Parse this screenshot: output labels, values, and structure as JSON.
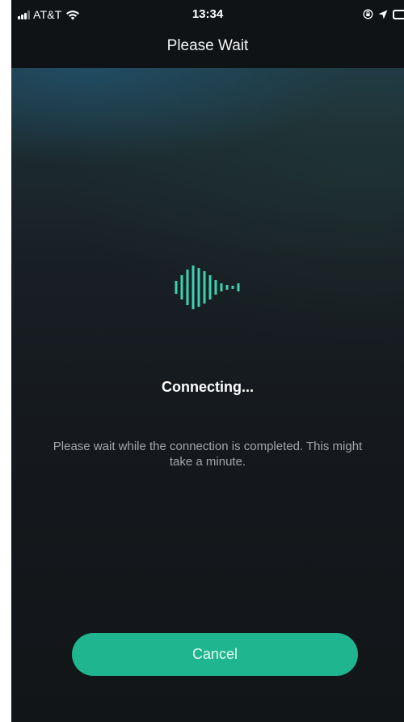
{
  "status_bar": {
    "carrier": "AT&T",
    "time": "13:34",
    "icons": [
      "signal-icon",
      "wifi-icon",
      "lock-rotation-icon",
      "location-icon",
      "battery-icon"
    ]
  },
  "nav": {
    "title": "Please Wait"
  },
  "main": {
    "heading": "Connecting...",
    "message": "Please wait while the connection is completed. This might take a minute.",
    "icon": "sound-wave-icon"
  },
  "actions": {
    "cancel_label": "Cancel"
  },
  "colors": {
    "accent": "#1fb58e",
    "wave": "#3ed1b0",
    "background": "#15181c",
    "text_secondary": "#a3a6aa"
  }
}
